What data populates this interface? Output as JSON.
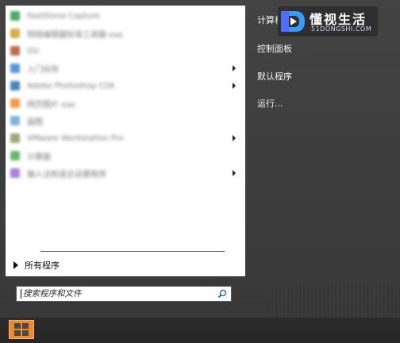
{
  "programs": [
    {
      "label": "FastStone Capture",
      "icon_color": "#2a9d4a",
      "icon": "app-icon",
      "has_submenu": false
    },
    {
      "label": "网络编辑器标准工具箱 exe",
      "icon_color": "#c9a227",
      "icon": "app-icon",
      "has_submenu": false
    },
    {
      "label": "GG",
      "icon_color": "#b5522c",
      "icon": "app-icon",
      "has_submenu": false
    },
    {
      "label": "入门向导",
      "icon_color": "#3a86d1",
      "icon": "app-icon",
      "has_submenu": true
    },
    {
      "label": "Adobe Photoshop CS6",
      "icon_color": "#2b6fb8",
      "icon": "app-icon",
      "has_submenu": true
    },
    {
      "label": "网页图片 exe",
      "icon_color": "#f08a2a",
      "icon": "app-icon",
      "has_submenu": false
    },
    {
      "label": "画图",
      "icon_color": "#6ba4d8",
      "icon": "app-icon",
      "has_submenu": false
    },
    {
      "label": "VMware Workstation Pro",
      "icon_color": "#8a9a5b",
      "icon": "app-icon",
      "has_submenu": true
    },
    {
      "label": "计算器",
      "icon_color": "#4caf50",
      "icon": "app-icon",
      "has_submenu": false
    },
    {
      "label": "输入法和语言设置程序",
      "icon_color": "#9c6ad6",
      "icon": "app-icon",
      "has_submenu": true
    }
  ],
  "all_programs_label": "所有程序",
  "search": {
    "placeholder": "搜索程序和文件"
  },
  "right_pane": {
    "computer": "计算机",
    "control_panel": "控制面板",
    "default_programs": "默认程序",
    "run": "运行..."
  },
  "watermark": {
    "cn": "懂视生活",
    "en": "51DONGSHI.COM"
  },
  "colors": {
    "start_button": "#f08a2a",
    "menu_bg": "#3b3b3b",
    "left_pane": "#ffffff"
  }
}
